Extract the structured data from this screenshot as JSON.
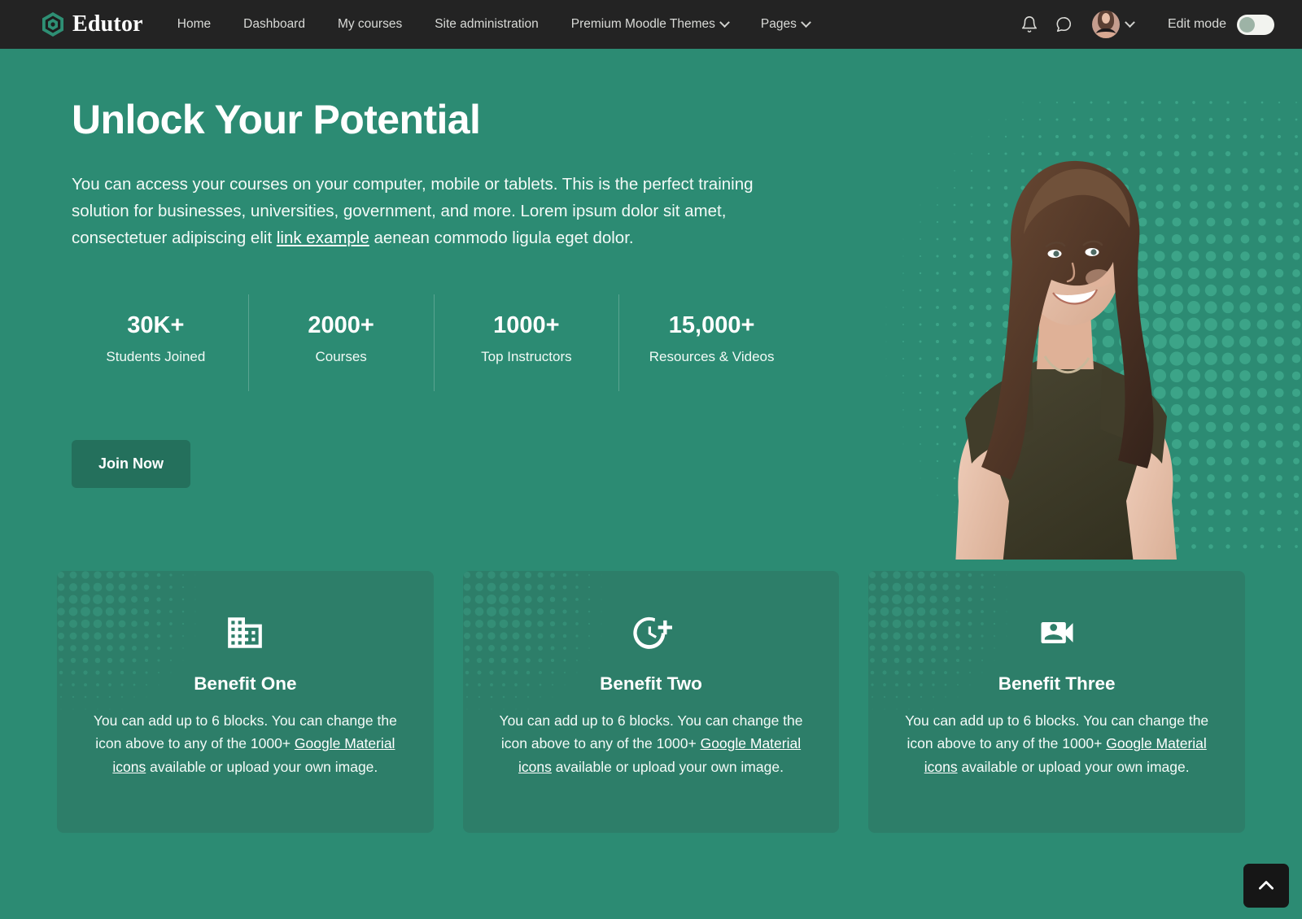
{
  "navbar": {
    "brand": {
      "name": "Edutor",
      "icon": "cube-logo-icon"
    },
    "links": [
      {
        "label": "Home",
        "has_caret": false
      },
      {
        "label": "Dashboard",
        "has_caret": false
      },
      {
        "label": "My courses",
        "has_caret": false
      },
      {
        "label": "Site administration",
        "has_caret": false
      },
      {
        "label": "Premium Moodle Themes",
        "has_caret": true
      },
      {
        "label": "Pages",
        "has_caret": true
      }
    ],
    "notifications_icon": "bell-icon",
    "messages_icon": "chat-bubble-icon",
    "avatar_icon": "user-avatar",
    "avatar_caret_icon": "chevron-down-icon",
    "edit_mode": {
      "label": "Edit mode",
      "state": "off"
    }
  },
  "hero": {
    "title": "Unlock Your Potential",
    "description_part1": "You can access your courses on your computer, mobile or tablets. This is the perfect training solution for businesses, universities, government, and more. Lorem ipsum dolor sit amet, consectetuer adipiscing elit ",
    "description_link": "link example",
    "description_part2": " aenean commodo ligula eget dolor.",
    "stats": [
      {
        "value": "30K+",
        "label": "Students Joined"
      },
      {
        "value": "2000+",
        "label": "Courses"
      },
      {
        "value": "1000+",
        "label": "Top Instructors"
      },
      {
        "value": "15,000+",
        "label": "Resources & Videos"
      }
    ],
    "cta_label": "Join Now",
    "photo_alt": "smiling-student-photo"
  },
  "benefits": [
    {
      "icon": "business-building-icon",
      "title": "Benefit One",
      "text_part1": "You can add up to 6 blocks. You can change the icon above to any of the 1000+ ",
      "link": "Google Material icons",
      "text_part2": " available or upload your own image."
    },
    {
      "icon": "more-time-clock-plus-icon",
      "title": "Benefit Two",
      "text_part1": "You can add up to 6 blocks. You can change the icon above to any of the 1000+ ",
      "link": "Google Material icons",
      "text_part2": " available or upload your own image."
    },
    {
      "icon": "video-camera-front-icon",
      "title": "Benefit Three",
      "text_part1": "You can add up to 6 blocks. You can change the icon above to any of the 1000+ ",
      "link": "Google Material icons",
      "text_part2": " available or upload your own image."
    }
  ],
  "scroll_top": {
    "icon": "chevron-up-icon",
    "label": ""
  },
  "colors": {
    "navbar_bg": "#232323",
    "hero_bg": "#2c8b73",
    "card_bg": "#2d7e69",
    "button_bg": "#24705c",
    "brand_accent": "#2e8f74",
    "text_light": "#f3faf7",
    "scroll_top_bg": "#161616"
  }
}
